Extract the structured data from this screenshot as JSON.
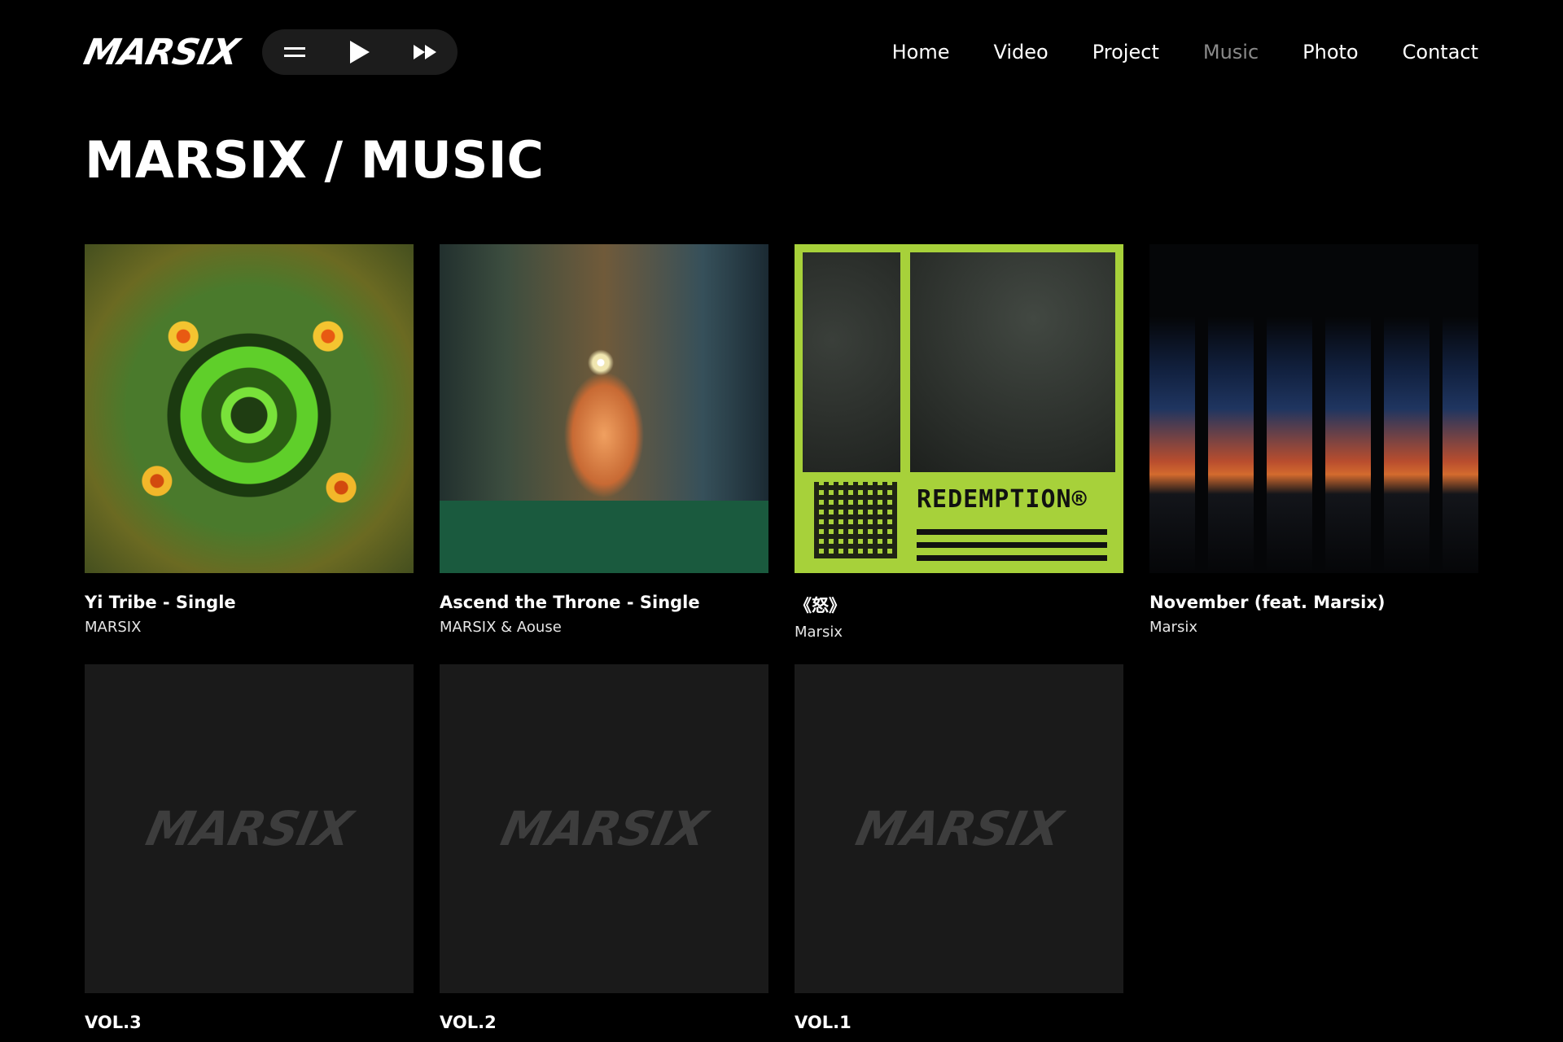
{
  "header": {
    "logo": "MARSIX",
    "player": {
      "menu_icon": "menu-icon",
      "play_icon": "play-icon",
      "forward_icon": "fast-forward-icon"
    },
    "nav": [
      {
        "label": "Home",
        "active": false
      },
      {
        "label": "Video",
        "active": false
      },
      {
        "label": "Project",
        "active": false
      },
      {
        "label": "Music",
        "active": true
      },
      {
        "label": "Photo",
        "active": false
      },
      {
        "label": "Contact",
        "active": false
      }
    ]
  },
  "page_title": "MARSIX / MUSIC",
  "releases": [
    {
      "title": "Yi Tribe - Single",
      "artist": "MARSIX"
    },
    {
      "title": "Ascend the Throne - Single",
      "artist": "MARSIX & Aouse"
    },
    {
      "title": "《怒》",
      "artist": "Marsix",
      "cover_text": "REDEMPTION®"
    },
    {
      "title": "November (feat. Marsix)",
      "artist": "Marsix"
    },
    {
      "title": "VOL.3",
      "cover_watermark": "MARSIX"
    },
    {
      "title": "VOL.2",
      "cover_watermark": "MARSIX"
    },
    {
      "title": "VOL.1",
      "cover_watermark": "MARSIX"
    }
  ],
  "colors": {
    "background": "#000000",
    "nav_active": "#8a8a8a",
    "player_bg": "#1c1c1c",
    "placeholder_bg": "#1a1a1a",
    "redemption_green": "#a7d13a"
  }
}
